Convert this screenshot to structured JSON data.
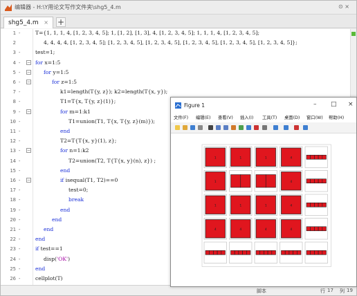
{
  "editor": {
    "title": "编辑器 - H:\\Y用论文写作文件夹\\shg5_4.m",
    "window_controls": "⊙ ×",
    "tab_label": "shg5_4.m",
    "tab_close": "×",
    "new_tab": "+",
    "lines": [
      {
        "n": "1",
        "dash": "-",
        "text": "T={1, 1, 1, 4, [1, 2, 3, 4, 5]; 1, [1, 2], [1, 3], 4, [1, 2, 3, 4, 5]; 1, 1, 1, 4, [1, 2, 3, 4, 5];"
      },
      {
        "n": "2",
        "dash": "",
        "text": "4, 4, 4, 4, [1, 2, 3, 4, 5]; [1, 2, 3, 4, 5], [1, 2, 3, 4, 5], [1, 2, 3, 4, 5], [1, 2, 3, 4, 5], [1, 2, 3, 4, 5]};"
      },
      {
        "n": "3",
        "dash": "-",
        "text": "test=1;"
      },
      {
        "n": "4",
        "dash": "-",
        "kw": "for",
        "text": " x=1:5"
      },
      {
        "n": "5",
        "dash": "-",
        "kw": "for",
        "text": " y=1:5"
      },
      {
        "n": "6",
        "dash": "-",
        "kw": "for",
        "text": " z=1:5"
      },
      {
        "n": "7",
        "dash": "-",
        "text": "k1=length(T{y, z}); k2=length(T{x, y});"
      },
      {
        "n": "8",
        "dash": "-",
        "text": "T1=T{x, T{y, z}(1)};"
      },
      {
        "n": "9",
        "dash": "-",
        "kw": "for",
        "text": " m=1:k1"
      },
      {
        "n": "10",
        "dash": "-",
        "text": "T1=union(T1, T{x, T{y, z}(m)});"
      },
      {
        "n": "11",
        "dash": "-",
        "kw": "end",
        "text": ""
      },
      {
        "n": "12",
        "dash": "-",
        "text": "T2=T{T{x, y}(1), z};"
      },
      {
        "n": "13",
        "dash": "-",
        "kw": "for",
        "text": " n=1:k2"
      },
      {
        "n": "14",
        "dash": "-",
        "text": "T2=union(T2, T{T{x, y}(n), z}) ;"
      },
      {
        "n": "15",
        "dash": "-",
        "kw": "end",
        "text": ""
      },
      {
        "n": "16",
        "dash": "-",
        "kw": "if",
        "text": " isequal(T1, T2)==0"
      },
      {
        "n": "17",
        "dash": "-",
        "text": "test=0;"
      },
      {
        "n": "18",
        "dash": "-",
        "kw": "break",
        "text": ""
      },
      {
        "n": "19",
        "dash": "-",
        "kw": "end",
        "text": ""
      },
      {
        "n": "20",
        "dash": "-",
        "kw": "end",
        "text": ""
      },
      {
        "n": "21",
        "dash": "-",
        "kw": "end",
        "text": ""
      },
      {
        "n": "22",
        "dash": "-",
        "kw": "end",
        "text": ""
      },
      {
        "n": "23",
        "dash": "-",
        "kw": "if",
        "text": " test==1"
      },
      {
        "n": "24",
        "dash": "-",
        "text": "disp(",
        "str": "'OK'",
        "tail": ")"
      },
      {
        "n": "25",
        "dash": "-",
        "kw": "end",
        "text": ""
      },
      {
        "n": "26",
        "dash": "-",
        "text": "cellplot(T)"
      }
    ],
    "status": {
      "mode": "脚本",
      "row_label": "行",
      "row": "17",
      "col_label": "列",
      "col": "19"
    }
  },
  "figure": {
    "title": "Figure 1",
    "controls": {
      "min": "–",
      "max": "□",
      "close": "×"
    },
    "menu": [
      "文件(F)",
      "编辑(E)",
      "查看(V)",
      "插入(I)",
      "工具(T)",
      "桌面(D)",
      "窗口(W)",
      "帮助(H)"
    ],
    "toolbar_icons": [
      "new-figure-icon",
      "open-icon",
      "save-icon",
      "print-icon",
      "pointer-icon",
      "zoom-in-icon",
      "zoom-out-icon",
      "pan-icon",
      "rotate-icon",
      "data-cursor-icon",
      "brush-icon",
      "link-icon",
      "colorbar-icon",
      "legend-icon",
      "hide-plot-tools-icon",
      "show-plot-tools-icon"
    ],
    "cellplot": {
      "rows": [
        [
          {
            "t": "s",
            "v": "1"
          },
          {
            "t": "s",
            "v": "1"
          },
          {
            "t": "s",
            "v": "1"
          },
          {
            "t": "s",
            "v": "4"
          },
          {
            "t": "v",
            "n": 5
          }
        ],
        [
          {
            "t": "s",
            "v": "1"
          },
          {
            "t": "v",
            "n": 2
          },
          {
            "t": "v",
            "n": 2
          },
          {
            "t": "s",
            "v": "4"
          },
          {
            "t": "v",
            "n": 5
          }
        ],
        [
          {
            "t": "s",
            "v": "1"
          },
          {
            "t": "s",
            "v": "1"
          },
          {
            "t": "s",
            "v": "1"
          },
          {
            "t": "s",
            "v": "4"
          },
          {
            "t": "v",
            "n": 5
          }
        ],
        [
          {
            "t": "s",
            "v": "4"
          },
          {
            "t": "s",
            "v": "4"
          },
          {
            "t": "s",
            "v": "4"
          },
          {
            "t": "s",
            "v": "4"
          },
          {
            "t": "v",
            "n": 5
          }
        ],
        [
          {
            "t": "v",
            "n": 5
          },
          {
            "t": "v",
            "n": 5
          },
          {
            "t": "v",
            "n": 5
          },
          {
            "t": "v",
            "n": 5
          },
          {
            "t": "v",
            "n": 5
          }
        ]
      ],
      "fill_color": "#e0161e",
      "edge_color": "#202020"
    }
  }
}
